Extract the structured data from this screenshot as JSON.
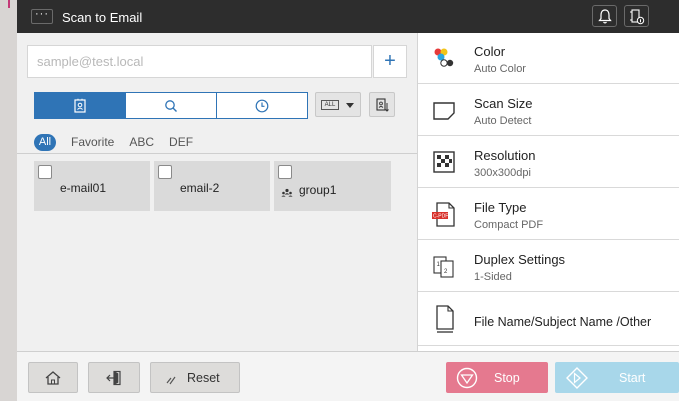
{
  "header": {
    "menu_label": "···",
    "title": "Scan to Email",
    "icons": [
      "bell-icon",
      "device-info-icon"
    ]
  },
  "destination": {
    "address_placeholder": "sample@test.local",
    "add_label": "+"
  },
  "tabs": {
    "items": [
      {
        "icon": "address-book-icon",
        "active": true
      },
      {
        "icon": "search-icon",
        "active": false
      },
      {
        "icon": "history-clock-icon",
        "active": false
      }
    ],
    "filter_value": "ALL",
    "sort_icon": "sort-icon"
  },
  "index": {
    "items": [
      "All",
      "Favorite",
      "ABC",
      "DEF"
    ],
    "active": "All"
  },
  "address_cards": [
    {
      "label": "e-mail01",
      "is_group": false
    },
    {
      "label": "email-2",
      "is_group": false
    },
    {
      "label": "group1",
      "is_group": true
    }
  ],
  "settings": [
    {
      "title": "Color",
      "value": "Auto Color",
      "icon": "color-icon"
    },
    {
      "title": "Scan Size",
      "value": "Auto Detect",
      "icon": "scan-size-icon"
    },
    {
      "title": "Resolution",
      "value": "300x300dpi",
      "icon": "resolution-icon"
    },
    {
      "title": "File Type",
      "value": "Compact PDF",
      "icon": "pdf-file-icon"
    },
    {
      "title": "Duplex Settings",
      "value": "1-Sided",
      "icon": "duplex-icon"
    },
    {
      "title": "File Name/Subject Name /Other",
      "value": "",
      "icon": "document-icon"
    }
  ],
  "footer": {
    "reset_label": "Reset",
    "stop_label": "Stop",
    "start_label": "Start"
  },
  "colors": {
    "accent": "#2f74b6",
    "stop": "#e5798f",
    "start": "#a8d7ea",
    "topbar": "#2d2d2d"
  }
}
